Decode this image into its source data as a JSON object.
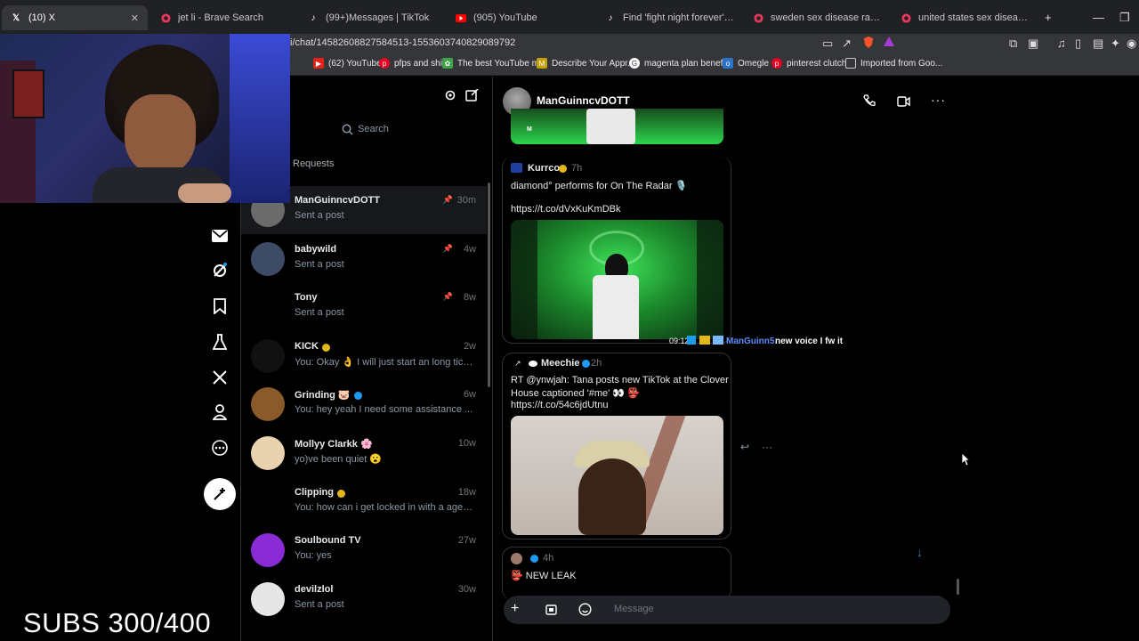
{
  "browser": {
    "tabs": [
      {
        "title": "(10) X",
        "icon": "x-logo-icon",
        "active": true
      },
      {
        "title": "jet li - Brave Search",
        "icon": "brave-search-icon"
      },
      {
        "title": "(99+)Messages | TikTok",
        "icon": "tiktok-icon"
      },
      {
        "title": "(905) YouTube",
        "icon": "youtube-icon"
      },
      {
        "title": "Find 'fight night forever' on TikTok |",
        "icon": "tiktok-icon"
      },
      {
        "title": "sweden sex disease rate - Brave Sear",
        "icon": "brave-search-icon"
      },
      {
        "title": "united states sex disease rate - Brave",
        "icon": "brave-search-icon"
      }
    ],
    "url": "i/chat/1458260882758451​3-1553603740829089792",
    "bookmarks": [
      {
        "label": "(62) YouTube",
        "color": "#e62117"
      },
      {
        "label": "pfps and shit",
        "color": "#e60023"
      },
      {
        "label": "The best YouTube m...",
        "color": "#3ea34b"
      },
      {
        "label": "Describe Your Appr...",
        "color": "#c5a000"
      },
      {
        "label": "magenta plan benef...",
        "color": "#e20074"
      },
      {
        "label": "Omegle",
        "color": "#2a73c9"
      },
      {
        "label": "pinterest clutch",
        "color": "#e60023"
      },
      {
        "label": "Imported from Goo...",
        "color": "#c9c9c9"
      }
    ]
  },
  "sidebar": {
    "search_placeholder": "Search",
    "requests_label": "Requests"
  },
  "conversations": [
    {
      "name": "ManGuinncvDOTT",
      "preview": "Sent a post",
      "time": "30m",
      "pinned": true,
      "selected": true,
      "verified": "",
      "avatar_color": "#6b6b6b"
    },
    {
      "name": "babywild",
      "preview": "Sent a post",
      "time": "4w",
      "pinned": true,
      "verified": "",
      "avatar_color": "#3d4b66"
    },
    {
      "name": "Tony",
      "preview": "Sent a post",
      "time": "8w",
      "pinned": true,
      "verified": "",
      "avatar_color": "#000000"
    },
    {
      "name": "KICK",
      "preview": "You: Okay 👌 I will just start an long ticke...",
      "time": "2w",
      "verified": "#e2b719",
      "avatar_color": "#111111"
    },
    {
      "name": "Grinding 🐷",
      "preview": "You: hey yeah I need some assistance ...",
      "time": "6w",
      "verified": "#1d9bf0",
      "avatar_color": "#8a5a2b"
    },
    {
      "name": "Mollyy Clarkk 🌸",
      "preview": "yo)ve been quiet 😮",
      "time": "10w",
      "verified": "",
      "avatar_color": "#e8d2b0"
    },
    {
      "name": "Clipping",
      "preview": "You: how can i get locked in with a agency...",
      "time": "18w",
      "verified": "#e2b719",
      "avatar_color": "#000000"
    },
    {
      "name": "Soulbound TV",
      "preview": "You: yes",
      "time": "27w",
      "verified": "",
      "avatar_color": "#8b2bd6"
    },
    {
      "name": "devilzlol",
      "preview": "Sent a post",
      "time": "30w",
      "verified": "",
      "avatar_color": "#e6e6e6"
    }
  ],
  "chat": {
    "header_name": "ManGuinncvDOTT",
    "posts": [
      {
        "author": "Kurrco",
        "time": "7h",
        "text": "diamond° performs for On The Radar 🎙️",
        "link": "https://t.co/dVxKuKmDBk"
      },
      {
        "author": "Meechie",
        "time": "2h",
        "text1": "RT @ynwjah: Tana posts new TikTok at the Clover",
        "text2": "House captioned '#me' 👀 👺",
        "link": "https://t.co/54c6jdUtnu"
      },
      {
        "author": "",
        "time": "4h",
        "text": "👺 NEW LEAK"
      }
    ],
    "stream_chat_time": "09:12",
    "stream_chat_user": "ManGuinn5:",
    "stream_chat_msg": "new voice I fw it",
    "message_placeholder": "Message"
  },
  "overlay": {
    "subs_text": "SUBS 300/400"
  },
  "colors": {
    "accent": "#1d9bf0",
    "verified_gold": "#e2b719",
    "background": "#000000",
    "video_green": "#2bd64b"
  }
}
